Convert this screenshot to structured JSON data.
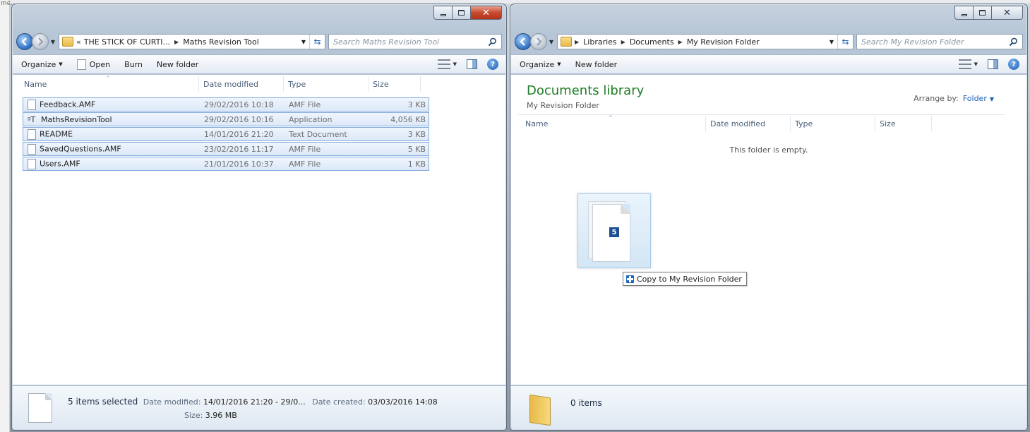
{
  "background": {
    "left_strip_fragment": "ment"
  },
  "left": {
    "address": {
      "overflow": "«",
      "crumbs": [
        "THE STICK OF CURTI...",
        "Maths Revision Tool"
      ],
      "search_placeholder": "Search Maths Revision Tool"
    },
    "commands": {
      "organize": "Organize",
      "open": "Open",
      "burn": "Burn",
      "new_folder": "New folder"
    },
    "columns": {
      "name": "Name",
      "date": "Date modified",
      "type": "Type",
      "size": "Size"
    },
    "files": [
      {
        "name": "Feedback.AMF",
        "date": "29/02/2016 10:18",
        "type": "AMF File",
        "size": "3 KB",
        "icon": "document-icon"
      },
      {
        "name": "MathsRevisionTool",
        "date": "29/02/2016 10:16",
        "type": "Application",
        "size": "4,056 KB",
        "icon": "application-icon"
      },
      {
        "name": "README",
        "date": "14/01/2016 21:20",
        "type": "Text Document",
        "size": "3 KB",
        "icon": "text-document-icon"
      },
      {
        "name": "SavedQuestions.AMF",
        "date": "23/02/2016 11:17",
        "type": "AMF File",
        "size": "5 KB",
        "icon": "document-icon"
      },
      {
        "name": "Users.AMF",
        "date": "21/01/2016 10:37",
        "type": "AMF File",
        "size": "1 KB",
        "icon": "document-icon"
      }
    ],
    "details": {
      "selected": "5 items selected",
      "modified_label": "Date modified:",
      "modified_value": "14/01/2016 21:20 - 29/0...",
      "created_label": "Date created:",
      "created_value": "03/03/2016 14:08",
      "size_label": "Size:",
      "size_value": "3.96 MB"
    }
  },
  "right": {
    "address": {
      "crumbs": [
        "Libraries",
        "Documents",
        "My Revision Folder"
      ],
      "search_placeholder": "Search My Revision Folder"
    },
    "commands": {
      "organize": "Organize",
      "new_folder": "New folder"
    },
    "library": {
      "title": "Documents library",
      "subtitle": "My Revision Folder",
      "arrange_label": "Arrange by:",
      "arrange_value": "Folder"
    },
    "columns": {
      "name": "Name",
      "date": "Date modified",
      "type": "Type",
      "size": "Size"
    },
    "empty_message": "This folder is empty.",
    "drag": {
      "count": "5",
      "tooltip": "Copy to My Revision Folder"
    },
    "details": {
      "count": "0 items"
    }
  },
  "colors": {
    "accent": "#1e7d26",
    "selection": "#dde9f8",
    "close_button": "#c74a2f"
  }
}
